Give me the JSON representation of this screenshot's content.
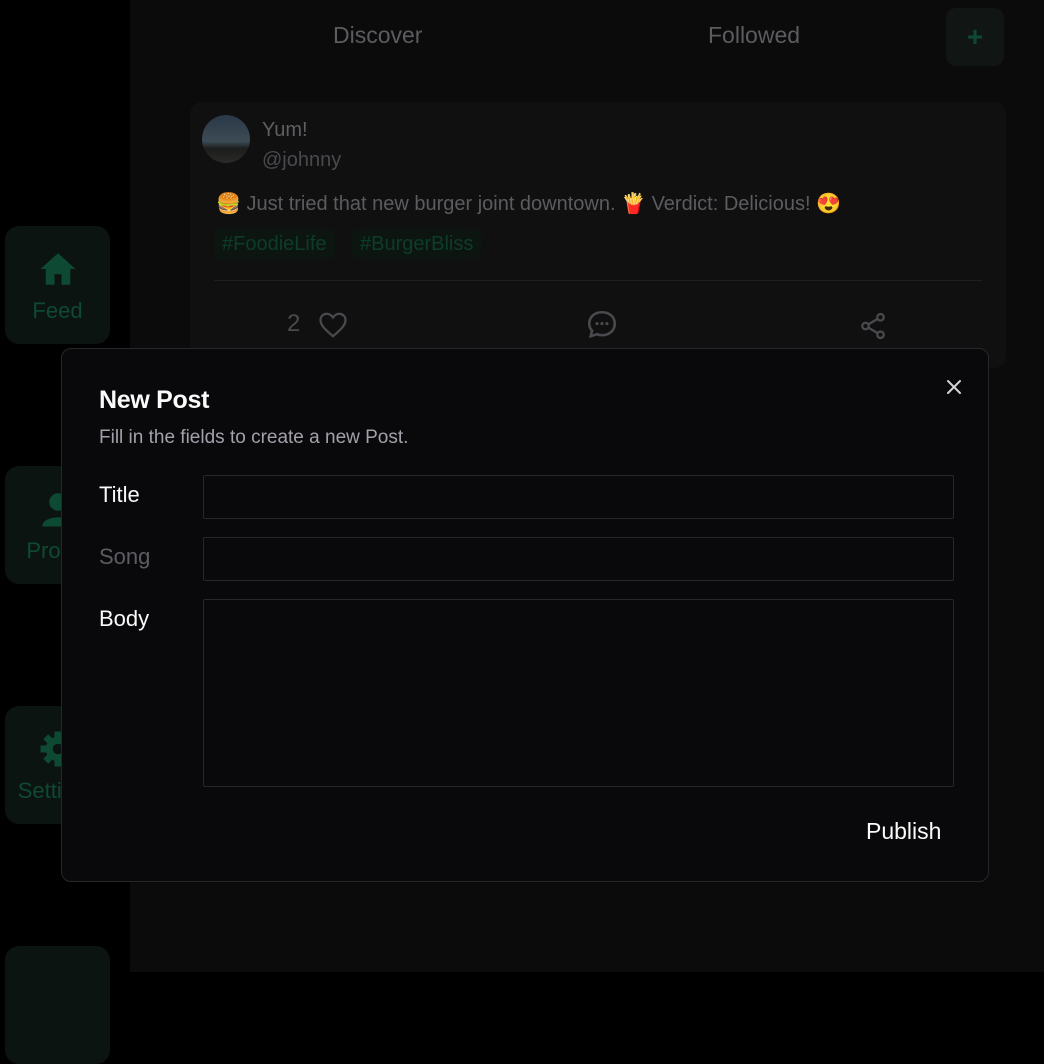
{
  "sidebar": {
    "items": [
      {
        "label": "Feed",
        "icon": "home-icon"
      },
      {
        "label": "Profile",
        "icon": "user-icon"
      },
      {
        "label": "Settings",
        "icon": "gear-icon"
      }
    ]
  },
  "tabs": [
    "Discover",
    "Followed"
  ],
  "add_button": {
    "label": "+"
  },
  "post": {
    "title": "Yum!",
    "handle": "@johnny",
    "body": "🍔 Just tried that new burger joint downtown. 🍟 Verdict: Delicious! 😍",
    "tags": [
      "#FoodieLife",
      "#BurgerBliss"
    ],
    "likes": "2"
  },
  "modal": {
    "title": "New Post",
    "description": "Fill in the fields to create a new Post.",
    "fields": {
      "title_label": "Title",
      "song_label": "Song",
      "body_label": "Body",
      "title_value": "",
      "song_value": "",
      "body_value": ""
    },
    "publish_label": "Publish"
  },
  "colors": {
    "accent": "#0e4a33",
    "modal_bg": "#09090b",
    "border": "#27272a",
    "text": "#fafafa",
    "muted": "#a1a1aa"
  }
}
